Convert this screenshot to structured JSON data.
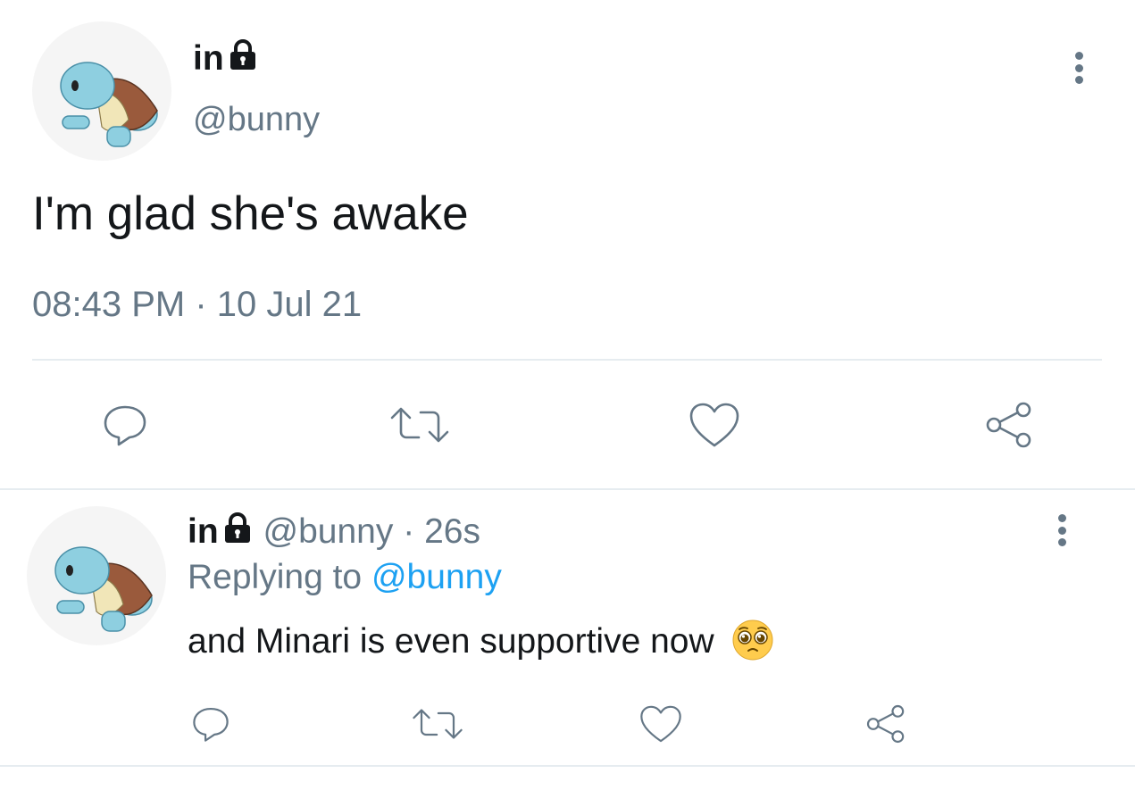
{
  "main_tweet": {
    "display_name": "in",
    "handle": "@bunny",
    "text": "I'm glad she's awake",
    "time": "08:43 PM",
    "separator": "·",
    "date": "10 Jul 21"
  },
  "reply": {
    "display_name": "in",
    "handle": "@bunny",
    "separator": "·",
    "age": "26s",
    "replying_prefix": "Replying to",
    "replying_to": "@bunny",
    "text": "and Minari is even supportive now",
    "emoji": "pleading-face-icon"
  },
  "actions": [
    "reply-icon",
    "retweet-icon",
    "like-icon",
    "share-icon"
  ],
  "colors": {
    "text": "#14171a",
    "secondary": "#657786",
    "link": "#1da1f2",
    "divider": "#e6ecf0"
  }
}
